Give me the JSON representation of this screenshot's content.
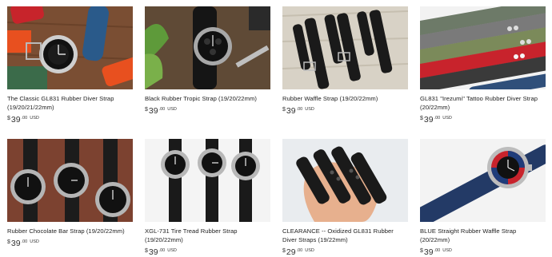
{
  "currency_symbol": "$",
  "currency_code": "USD",
  "products": [
    {
      "title": "The Classic GL831 Rubber Diver Strap (19/20/21/22mm)",
      "price_int": "39",
      "price_cents": ".00"
    },
    {
      "title": "Black Rubber Tropic Strap (19/20/22mm)",
      "price_int": "39",
      "price_cents": ".00"
    },
    {
      "title": "Rubber Waffle Strap (19/20/22mm)",
      "price_int": "39",
      "price_cents": ".00"
    },
    {
      "title": "GL831 \"Irezumi\" Tattoo Rubber Diver Strap (20/22mm)",
      "price_int": "39",
      "price_cents": ".00"
    },
    {
      "title": "Rubber Chocolate Bar Strap (19/20/22mm)",
      "price_int": "39",
      "price_cents": ".00"
    },
    {
      "title": "XGL-731 Tire Tread Rubber Strap (19/20/22mm)",
      "price_int": "39",
      "price_cents": ".00"
    },
    {
      "title": "CLEARANCE -- Oxidized GL831 Rubber Diver Straps (19/22mm)",
      "price_int": "29",
      "price_cents": ".00"
    },
    {
      "title": "BLUE Straight Rubber Waffle Strap (20/22mm)",
      "price_int": "39",
      "price_cents": ".00"
    }
  ]
}
